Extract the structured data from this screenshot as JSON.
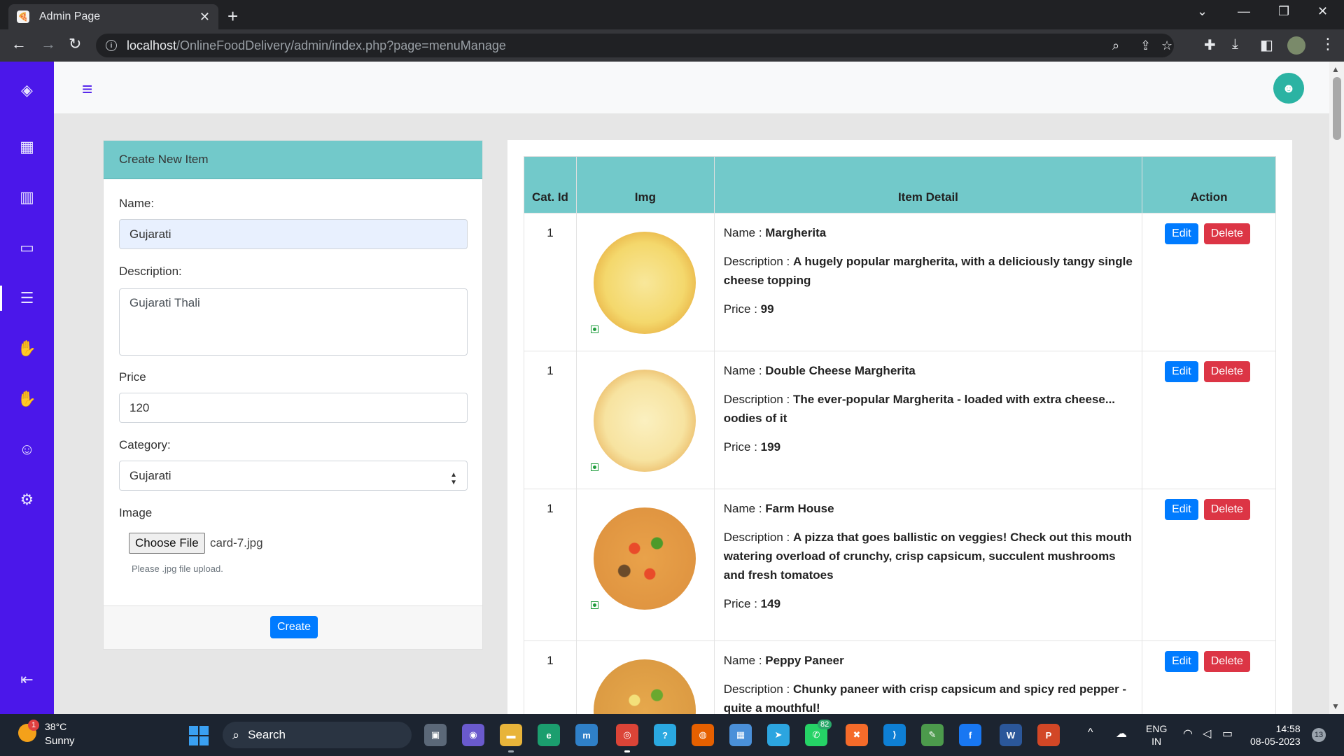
{
  "browser": {
    "tab_title": "Admin Page",
    "url_host": "localhost",
    "url_path": "/OnlineFoodDelivery/admin/index.php?page=menuManage"
  },
  "form": {
    "header": "Create New Item",
    "name_label": "Name:",
    "name_value": "Gujarati",
    "description_label": "Description:",
    "description_value": "Gujarati Thali",
    "price_label": "Price",
    "price_value": "120",
    "category_label": "Category:",
    "category_value": "Gujarati",
    "image_label": "Image",
    "choose_file_label": "Choose File",
    "file_name": "card-7.jpg",
    "file_help": "Please .jpg file upload.",
    "create_label": "Create"
  },
  "table": {
    "headers": {
      "cat_id": "Cat. Id",
      "img": "Img",
      "detail": "Item Detail",
      "action": "Action"
    },
    "name_prefix": "Name : ",
    "description_prefix": "Description : ",
    "price_prefix": "Price : ",
    "edit_label": "Edit",
    "delete_label": "Delete",
    "rows": [
      {
        "cat_id": "1",
        "name": "Margherita",
        "description": "A hugely popular margherita, with a deliciously tangy single cheese topping",
        "price": "99"
      },
      {
        "cat_id": "1",
        "name": "Double Cheese Margherita",
        "description": "The ever-popular Margherita - loaded with extra cheese... oodies of it",
        "price": "199"
      },
      {
        "cat_id": "1",
        "name": "Farm House",
        "description": "A pizza that goes ballistic on veggies! Check out this mouth watering overload of crunchy, crisp capsicum, succulent mushrooms and fresh tomatoes",
        "price": "149"
      },
      {
        "cat_id": "1",
        "name": "Peppy Paneer",
        "description": "Chunky paneer with crisp capsicum and spicy red pepper - quite a mouthful!",
        "price": ""
      }
    ]
  },
  "taskbar": {
    "weather_badge": "1",
    "temperature": "38°C",
    "condition": "Sunny",
    "search_label": "Search",
    "whatsapp_badge": "82",
    "lang_1": "ENG",
    "lang_2": "IN",
    "time": "14:58",
    "date": "08-05-2023",
    "notification_count": "13"
  },
  "colors": {
    "sidebar": "#4b17ea",
    "card_header": "#72c9ca",
    "primary": "#007bff",
    "danger": "#dc3545"
  }
}
